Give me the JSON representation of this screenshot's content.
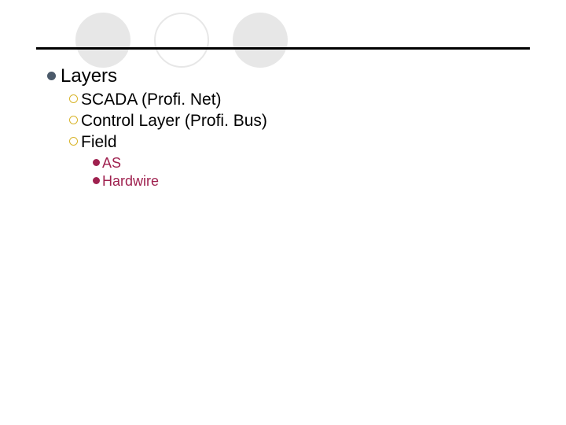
{
  "items": [
    {
      "text": "Layers",
      "children": [
        {
          "text": "SCADA (Profi. Net)"
        },
        {
          "text": "Control Layer (Profi. Bus)"
        },
        {
          "text": "Field",
          "children": [
            {
              "text": "AS"
            },
            {
              "text": "Hardwire"
            }
          ]
        }
      ]
    }
  ]
}
